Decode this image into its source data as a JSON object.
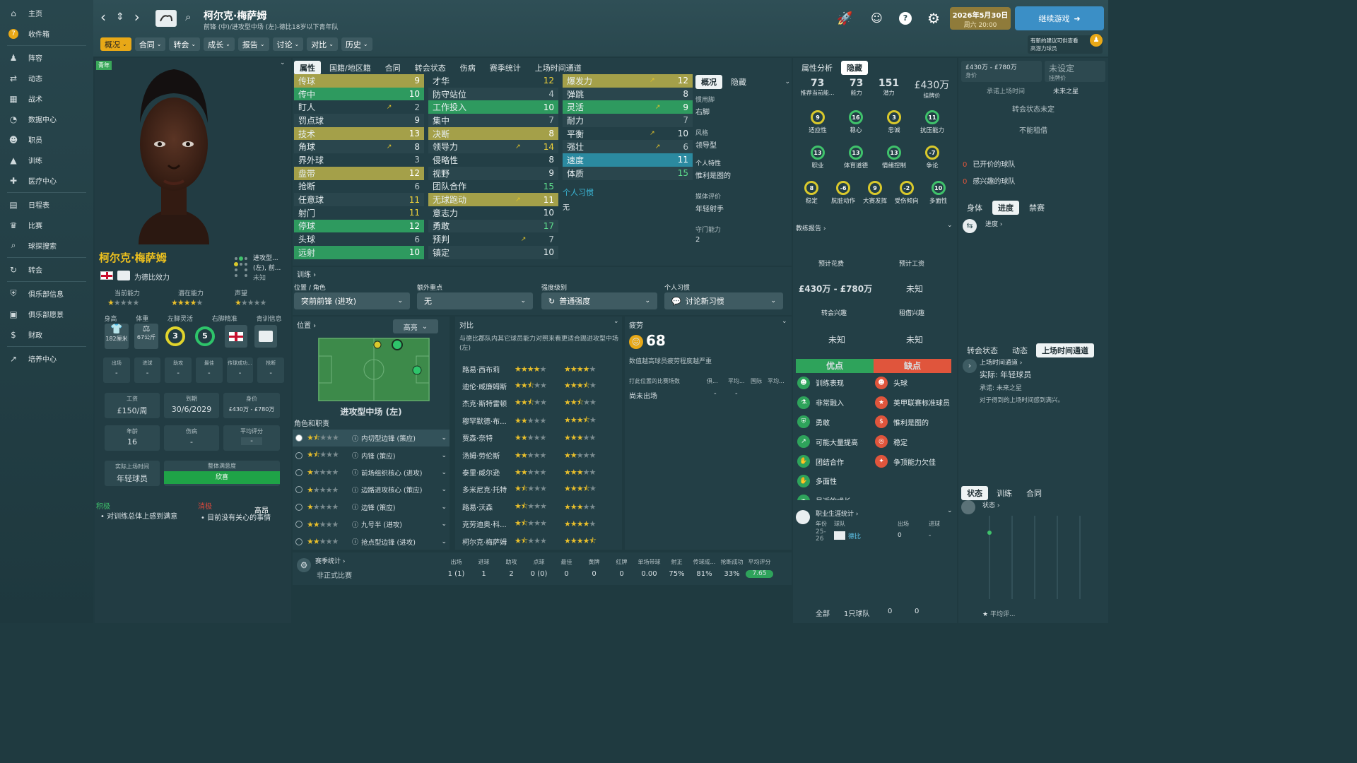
{
  "sidebar": {
    "items": [
      {
        "label": "主页",
        "icon": "home-icon"
      },
      {
        "label": "收件箱",
        "icon": "inbox-icon",
        "badge": "7"
      },
      {
        "label": "阵容",
        "icon": "squad-icon"
      },
      {
        "label": "动态",
        "icon": "dynamics-icon"
      },
      {
        "label": "战术",
        "icon": "tactics-icon"
      },
      {
        "label": "数据中心",
        "icon": "data-hub-icon"
      },
      {
        "label": "职员",
        "icon": "staff-icon"
      },
      {
        "label": "训练",
        "icon": "training-icon"
      },
      {
        "label": "医疗中心",
        "icon": "medical-icon"
      },
      {
        "label": "日程表",
        "icon": "calendar-icon"
      },
      {
        "label": "比赛",
        "icon": "trophy-icon"
      },
      {
        "label": "球探搜索",
        "icon": "scouting-icon"
      },
      {
        "label": "转会",
        "icon": "transfer-icon"
      },
      {
        "label": "俱乐部信息",
        "icon": "club-info-icon"
      },
      {
        "label": "俱乐部愿景",
        "icon": "club-vision-icon"
      },
      {
        "label": "财政",
        "icon": "finance-icon"
      },
      {
        "label": "培养中心",
        "icon": "development-icon"
      }
    ]
  },
  "header": {
    "player_name": "柯尔克·梅萨姆",
    "subtitle": "前锋 (中)/进攻型中场 (左)-德比18岁以下青年队",
    "date": "2026年5月30日",
    "time": "周六 20:00",
    "continue": "继续游戏",
    "notice_line1": "有新的建议可供查看",
    "notice_line2": "高潜力球员"
  },
  "tabs": [
    "概况",
    "合同",
    "转会",
    "成长",
    "报告",
    "讨论",
    "对比",
    "历史"
  ],
  "left": {
    "youth_badge": "青年",
    "name": "柯尔克·梅萨姆",
    "plays_for": "为德比效力",
    "position_short": "进攻型...",
    "position_short2": "(左), 前...",
    "position_unknown": "未知",
    "labels": {
      "ca": "当前能力",
      "pa": "潜在能力",
      "rep": "声望",
      "height": "身高",
      "weight": "体重",
      "left_foot": "左脚灵活",
      "right_foot": "右脚精准",
      "youth_info": "青训信息"
    },
    "height": "182厘米",
    "weight": "67公斤",
    "left_foot": "3",
    "right_foot": "5",
    "stat_labels": [
      "出场",
      "进球",
      "助攻",
      "最佳",
      "传球成功...",
      "抢断"
    ],
    "stat_values": [
      "-",
      "-",
      "-",
      "-",
      "-",
      "-"
    ],
    "wage_label": "工资",
    "wage": "£150/周",
    "expiry_label": "到期",
    "expiry": "30/6/2029",
    "value_label": "身价",
    "value": "£430万 - £780万",
    "age_label": "年龄",
    "age": "16",
    "injury_label": "伤病",
    "injury": "-",
    "rating_label": "平均评分",
    "rating": "-",
    "playtime_label": "实际上场时间",
    "playtime": "年轻球员",
    "morale_label": "整体满意度",
    "morale": "欣喜",
    "positive_title": "积极",
    "positive_text": "对训练总体上感到满意",
    "negative_title": "消极",
    "negative_text": "目前没有关心的事情",
    "floating": "高昂"
  },
  "attr_tabs": [
    "属性",
    "国籍/地区籍",
    "合同",
    "转会状态",
    "伤病",
    "赛季统计",
    "上场时间通道"
  ],
  "technical": [
    [
      "传球",
      "9"
    ],
    [
      "传中",
      "10"
    ],
    [
      "盯人",
      "2"
    ],
    [
      "罚点球",
      "9"
    ],
    [
      "技术",
      "13"
    ],
    [
      "角球",
      "8"
    ],
    [
      "界外球",
      "3"
    ],
    [
      "盘带",
      "12"
    ],
    [
      "抢断",
      "6"
    ],
    [
      "任意球",
      "11"
    ],
    [
      "射门",
      "11"
    ],
    [
      "停球",
      "12"
    ],
    [
      "头球",
      "6"
    ],
    [
      "远射",
      "10"
    ]
  ],
  "mental": [
    [
      "才华",
      "12"
    ],
    [
      "防守站位",
      "4"
    ],
    [
      "工作投入",
      "10"
    ],
    [
      "集中",
      "7"
    ],
    [
      "决断",
      "8"
    ],
    [
      "领导力",
      "14"
    ],
    [
      "侵略性",
      "8"
    ],
    [
      "视野",
      "9"
    ],
    [
      "团队合作",
      "15"
    ],
    [
      "无球跑动",
      "11"
    ],
    [
      "意志力",
      "10"
    ],
    [
      "勇敢",
      "17"
    ],
    [
      "预判",
      "7"
    ],
    [
      "镇定",
      "10"
    ]
  ],
  "physical": [
    [
      "爆发力",
      "12"
    ],
    [
      "弹跳",
      "8"
    ],
    [
      "灵活",
      "9"
    ],
    [
      "耐力",
      "7"
    ],
    [
      "平衡",
      "10"
    ],
    [
      "强壮",
      "6"
    ],
    [
      "速度",
      "11"
    ],
    [
      "体质",
      "15"
    ]
  ],
  "personal_habits_title": "个人习惯",
  "personal_habits": "无",
  "side_info": {
    "tab1": "概况",
    "tab2": "隐藏",
    "pref_foot_label": "惯用脚",
    "pref_foot": "右脚",
    "style_label": "风格",
    "style": "领导型",
    "trait_label": "个人特性",
    "trait": "惟利是图的",
    "media_label": "媒体评价",
    "media": "年轻射手",
    "def_label": "守门能力",
    "def": "2"
  },
  "training": {
    "title": "训练",
    "pos_label": "位置 / 角色",
    "pos_value": "突前前锋 (进攻)",
    "extra_label": "额外重点",
    "extra_value": "无",
    "intensity_label": "强度级别",
    "intensity_value": "普通强度",
    "habit_label": "个人习惯",
    "habit_value": "讨论新习惯"
  },
  "position": {
    "title": "位置",
    "level": "高亮",
    "name": "进攻型中场 (左)",
    "roles_title": "角色和职责",
    "roles": [
      "内切型边锋 (策应)",
      "内锋 (策应)",
      "前场组织核心 (进攻)",
      "边路进攻核心 (策应)",
      "边锋 (策应)",
      "九号半 (进攻)",
      "抢点型边锋 (进攻)"
    ]
  },
  "compare": {
    "title": "对比",
    "desc": "与德比郡队内其它球员能力对照来看更适合踢进攻型中场 (左)",
    "players": [
      "路易·西布莉",
      "迪伦·威廉姆斯",
      "杰克·斯特雷顿",
      "穆罕默德·布...",
      "贾森·奈特",
      "汤姆·劳伦斯",
      "泰里·威尔逊",
      "多米尼克·托特",
      "路易·沃森",
      "克劳迪奥·科...",
      "柯尔克·梅萨姆"
    ]
  },
  "fatigue": {
    "title": "疲劳",
    "value": "68",
    "desc": "数值越高球员疲劳程度越严重",
    "table_title": "打此位置的比赛场数",
    "cols": [
      "俱...",
      "平均...",
      "国际",
      "平均..."
    ],
    "row_label": "尚未出场",
    "row_vals": [
      "-",
      "-"
    ]
  },
  "season": {
    "title": "赛季统计",
    "row_label": "非正式比赛",
    "cols": [
      "出场",
      "进球",
      "助攻",
      "点球",
      "最佳",
      "黄牌",
      "红牌",
      "单场带球",
      "射正",
      "传球成...",
      "抢断成功",
      "平均评分"
    ],
    "vals": [
      "1 (1)",
      "1",
      "2",
      "0 (0)",
      "0",
      "0",
      "0",
      "0.00",
      "75%",
      "81%",
      "33%",
      "7.65"
    ]
  },
  "analysis": {
    "tab1": "属性分析",
    "tab2": "隐藏",
    "ca": "73",
    "ca_label": "推荐当前能...",
    "pa": "73",
    "pa_label": "能力",
    "potential": "151",
    "potential_label": "潜力",
    "value": "£430万",
    "value_label": "挂牌价",
    "gauges1": [
      [
        "9",
        "适应性"
      ],
      [
        "16",
        "稳心"
      ],
      [
        "3",
        "忠诚"
      ],
      [
        "11",
        "抗压能力"
      ]
    ],
    "gauges2": [
      [
        "13",
        "职业"
      ],
      [
        "13",
        "体育道德"
      ],
      [
        "13",
        "情绪控制"
      ],
      [
        "-7",
        "争论"
      ]
    ],
    "gauges3": [
      [
        "8",
        "稳定"
      ],
      [
        "-6",
        "肮脏动作"
      ],
      [
        "9",
        "大赛发挥"
      ],
      [
        "-2",
        "受伤倾向"
      ],
      [
        "10",
        "多面性"
      ]
    ],
    "coach_title": "教练报告",
    "est_cost_label": "预计花费",
    "est_wage_label": "预计工资",
    "est_cost": "£430万 - £780万",
    "est_wage": "未知",
    "transfer_int_label": "转会兴趣",
    "loan_int_label": "租借兴趣",
    "transfer_int": "未知",
    "loan_int": "未知",
    "pros_title": "优点",
    "cons_title": "缺点",
    "pros": [
      "训练表现",
      "非常融入",
      "勇敢",
      "可能大量提高",
      "团结合作",
      "多面性",
      "最近的成长"
    ],
    "cons": [
      "头球",
      "英甲联赛标准球员",
      "惟利是图的",
      "稳定",
      "争顶能力欠佳"
    ],
    "career_title": "职业生涯统计",
    "career_cols": [
      "年份",
      "球队",
      "出场",
      "进球"
    ],
    "career_row": [
      "25-26",
      "德比",
      "0",
      "-"
    ],
    "career_total": [
      "全部",
      "1只球队",
      "0",
      "0"
    ]
  },
  "right": {
    "value_range": "£430万 - £780万",
    "value_label": "身价",
    "asking": "未设定",
    "asking_label": "挂牌价",
    "promised": "承诺上场时间",
    "promised_val": "未来之星",
    "transfer_status": "转会状态未定",
    "loan": "不能租借",
    "clubs_interested": "已开价的球队",
    "clubs_interested_n": "0",
    "clubs_keen": "感兴趣的球队",
    "clubs_keen_n": "0",
    "tabs1": [
      "身体",
      "进度",
      "禁赛"
    ],
    "progress": "进度",
    "tabs2": [
      "转会状态",
      "动态",
      "上场时间通道"
    ],
    "pt_title": "上场时间通道",
    "pt_actual": "实际: 年轻球员",
    "pt_promise": "承诺: 未来之星",
    "pt_note": "对于得到的上场时间感到满兴。",
    "tabs3": [
      "状态",
      "训练",
      "合同"
    ],
    "status": "状态",
    "avg_label": "平均评..."
  }
}
